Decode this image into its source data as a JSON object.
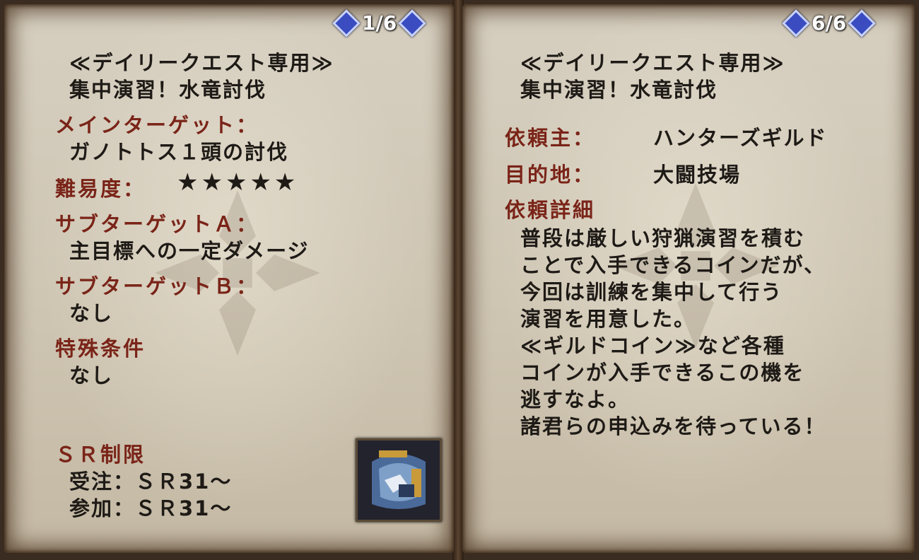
{
  "left_page": {
    "pager": "1/6",
    "quest_title_line1": "≪デイリークエスト専用≫",
    "quest_title_line2": "集中演習！水竜討伐",
    "main_target_label": "メインターゲット：",
    "main_target_value": "ガノトトス１頭の討伐",
    "difficulty_label": "難易度：",
    "difficulty_stars": "★★★★★",
    "difficulty_rating": 5,
    "sub_target_a_label": "サブターゲットＡ：",
    "sub_target_a_value": "主目標への一定ダメージ",
    "sub_target_b_label": "サブターゲットＢ：",
    "sub_target_b_value": "なし",
    "special_conditions_label": "特殊条件",
    "special_conditions_value": "なし",
    "sr_limit_label": "ＳＲ制限",
    "sr_order": "受注：ＳＲ31～",
    "sr_join": "参加：ＳＲ31～",
    "quest_icon": "ganotos-monster-icon"
  },
  "right_page": {
    "pager": "6/6",
    "quest_title_line1": "≪デイリークエスト専用≫",
    "quest_title_line2": "集中演習！水竜討伐",
    "client_label": "依頼主：",
    "client_value": "ハンターズギルド",
    "destination_label": "目的地：",
    "destination_value": "大闘技場",
    "details_label": "依頼詳細",
    "details_lines": [
      "普段は厳しい狩猟演習を積む",
      "ことで入手できるコインだが、",
      "今回は訓練を集中して行う",
      "演習を用意した。",
      "≪ギルドコイン≫など各種",
      "コインが入手できるこの機を",
      "逃すなよ。",
      "諸君らの申込みを待っている！"
    ]
  },
  "colors": {
    "label_red": "#7a2418",
    "text_dark": "#1e1a16",
    "parchment": "#d6cfc0",
    "pager_diamond": "#3a4cc0"
  }
}
